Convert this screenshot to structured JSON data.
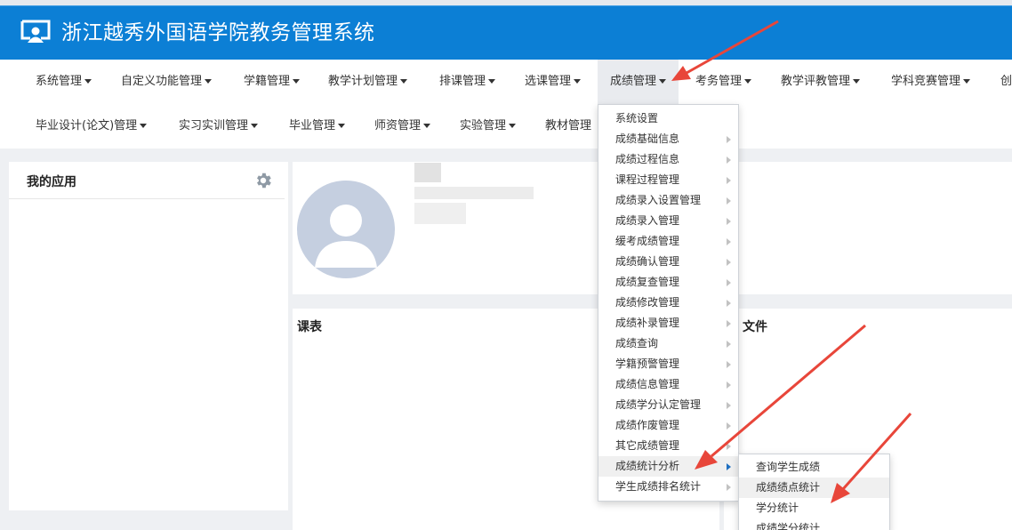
{
  "header": {
    "title": "浙江越秀外国语学院教务管理系统"
  },
  "nav": {
    "row1": [
      "系统管理",
      "自定义功能管理",
      "学籍管理",
      "教学计划管理",
      "排课管理",
      "选课管理",
      "成绩管理",
      "考务管理",
      "教学评教管理",
      "学科竞赛管理",
      "创"
    ],
    "row2": [
      "毕业设计(论文)管理",
      "实习实训管理",
      "毕业管理",
      "师资管理",
      "实验管理",
      "教材管理"
    ]
  },
  "sidebar": {
    "title": "我的应用",
    "settings_icon": "gear-icon"
  },
  "panels": {
    "schedule_title": "课表",
    "files_title": "文件"
  },
  "dropdown": {
    "items": [
      "系统设置",
      "成绩基础信息",
      "成绩过程信息",
      "课程过程管理",
      "成绩录入设置管理",
      "成绩录入管理",
      "缓考成绩管理",
      "成绩确认管理",
      "成绩复查管理",
      "成绩修改管理",
      "成绩补录管理",
      "成绩查询",
      "学籍预警管理",
      "成绩信息管理",
      "成绩学分认定管理",
      "成绩作废管理",
      "其它成绩管理",
      "成绩统计分析",
      "学生成绩排名统计"
    ]
  },
  "submenu": {
    "items": [
      "查询学生成绩",
      "成绩绩点统计",
      "学分统计",
      "成绩学分统计"
    ]
  },
  "colors": {
    "header": "#0c7fd5",
    "arrow": "#e8463a",
    "avatar": "#c5cfe0"
  }
}
